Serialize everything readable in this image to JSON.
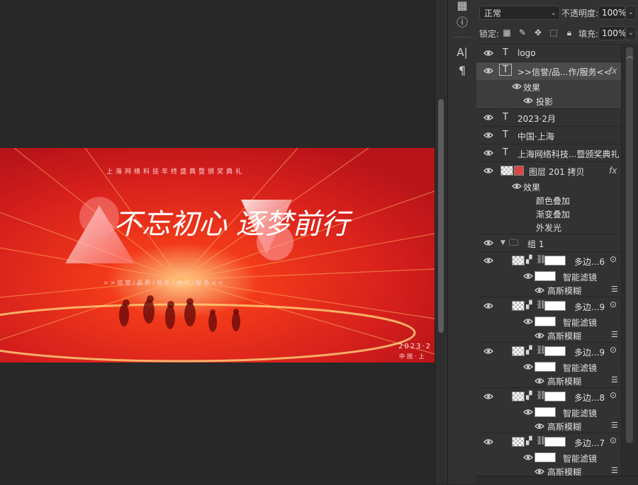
{
  "canvas": {
    "banner": {
      "top_text": "上海网络科技年终盛典暨颁奖典礼",
      "calligraphy": "不忘初心 逐梦前行",
      "slogan": ">>信誉/品质/创新/合作/服务<<",
      "date": "2023·2",
      "location": "中国·上",
      "bg_color": "#c81818"
    }
  },
  "toolstrip": {
    "icons": [
      "pages-icon",
      "info-icon",
      "character-icon",
      "paragraph-icon"
    ],
    "glyphs": [
      "▦",
      "ⓘ",
      "A|",
      "¶"
    ]
  },
  "layers_panel": {
    "blend_mode": "正常",
    "opacity_label": "不透明度:",
    "opacity_value": "100%",
    "lock_label": "锁定:",
    "fill_label": "填充:",
    "fill_value": "100%",
    "layers": [
      {
        "name": "logo",
        "kind": "text"
      },
      {
        "name": ">>信誉/品...作/服务<<",
        "kind": "text",
        "fx": "fx",
        "selected": true,
        "effects_label": "效果",
        "effects": [
          "投影"
        ]
      },
      {
        "name": "2023·2月",
        "kind": "text"
      },
      {
        "name": "中国·上海",
        "kind": "text"
      },
      {
        "name": "上海网络科技...暨颁奖典礼",
        "kind": "text"
      },
      {
        "name": "图层 201 拷贝",
        "kind": "pixel",
        "fx": "fx",
        "effects_label": "效果",
        "effects": [
          "颜色叠加",
          "渐变叠加",
          "外发光"
        ]
      },
      {
        "name": "组 1",
        "kind": "group"
      }
    ],
    "smart_objects": [
      {
        "name": "多边...6",
        "filter_label": "智能滤镜",
        "filter": "高斯模糊"
      },
      {
        "name": "多边...9",
        "filter_label": "智能滤镜",
        "filter": "高斯模糊"
      },
      {
        "name": "多边...9",
        "filter_label": "智能滤镜",
        "filter": "高斯模糊"
      },
      {
        "name": "多边...8",
        "filter_label": "智能滤镜",
        "filter": "高斯模糊"
      },
      {
        "name": "多边...7",
        "filter_label": "智能滤镜",
        "filter": "高斯模糊"
      }
    ]
  }
}
